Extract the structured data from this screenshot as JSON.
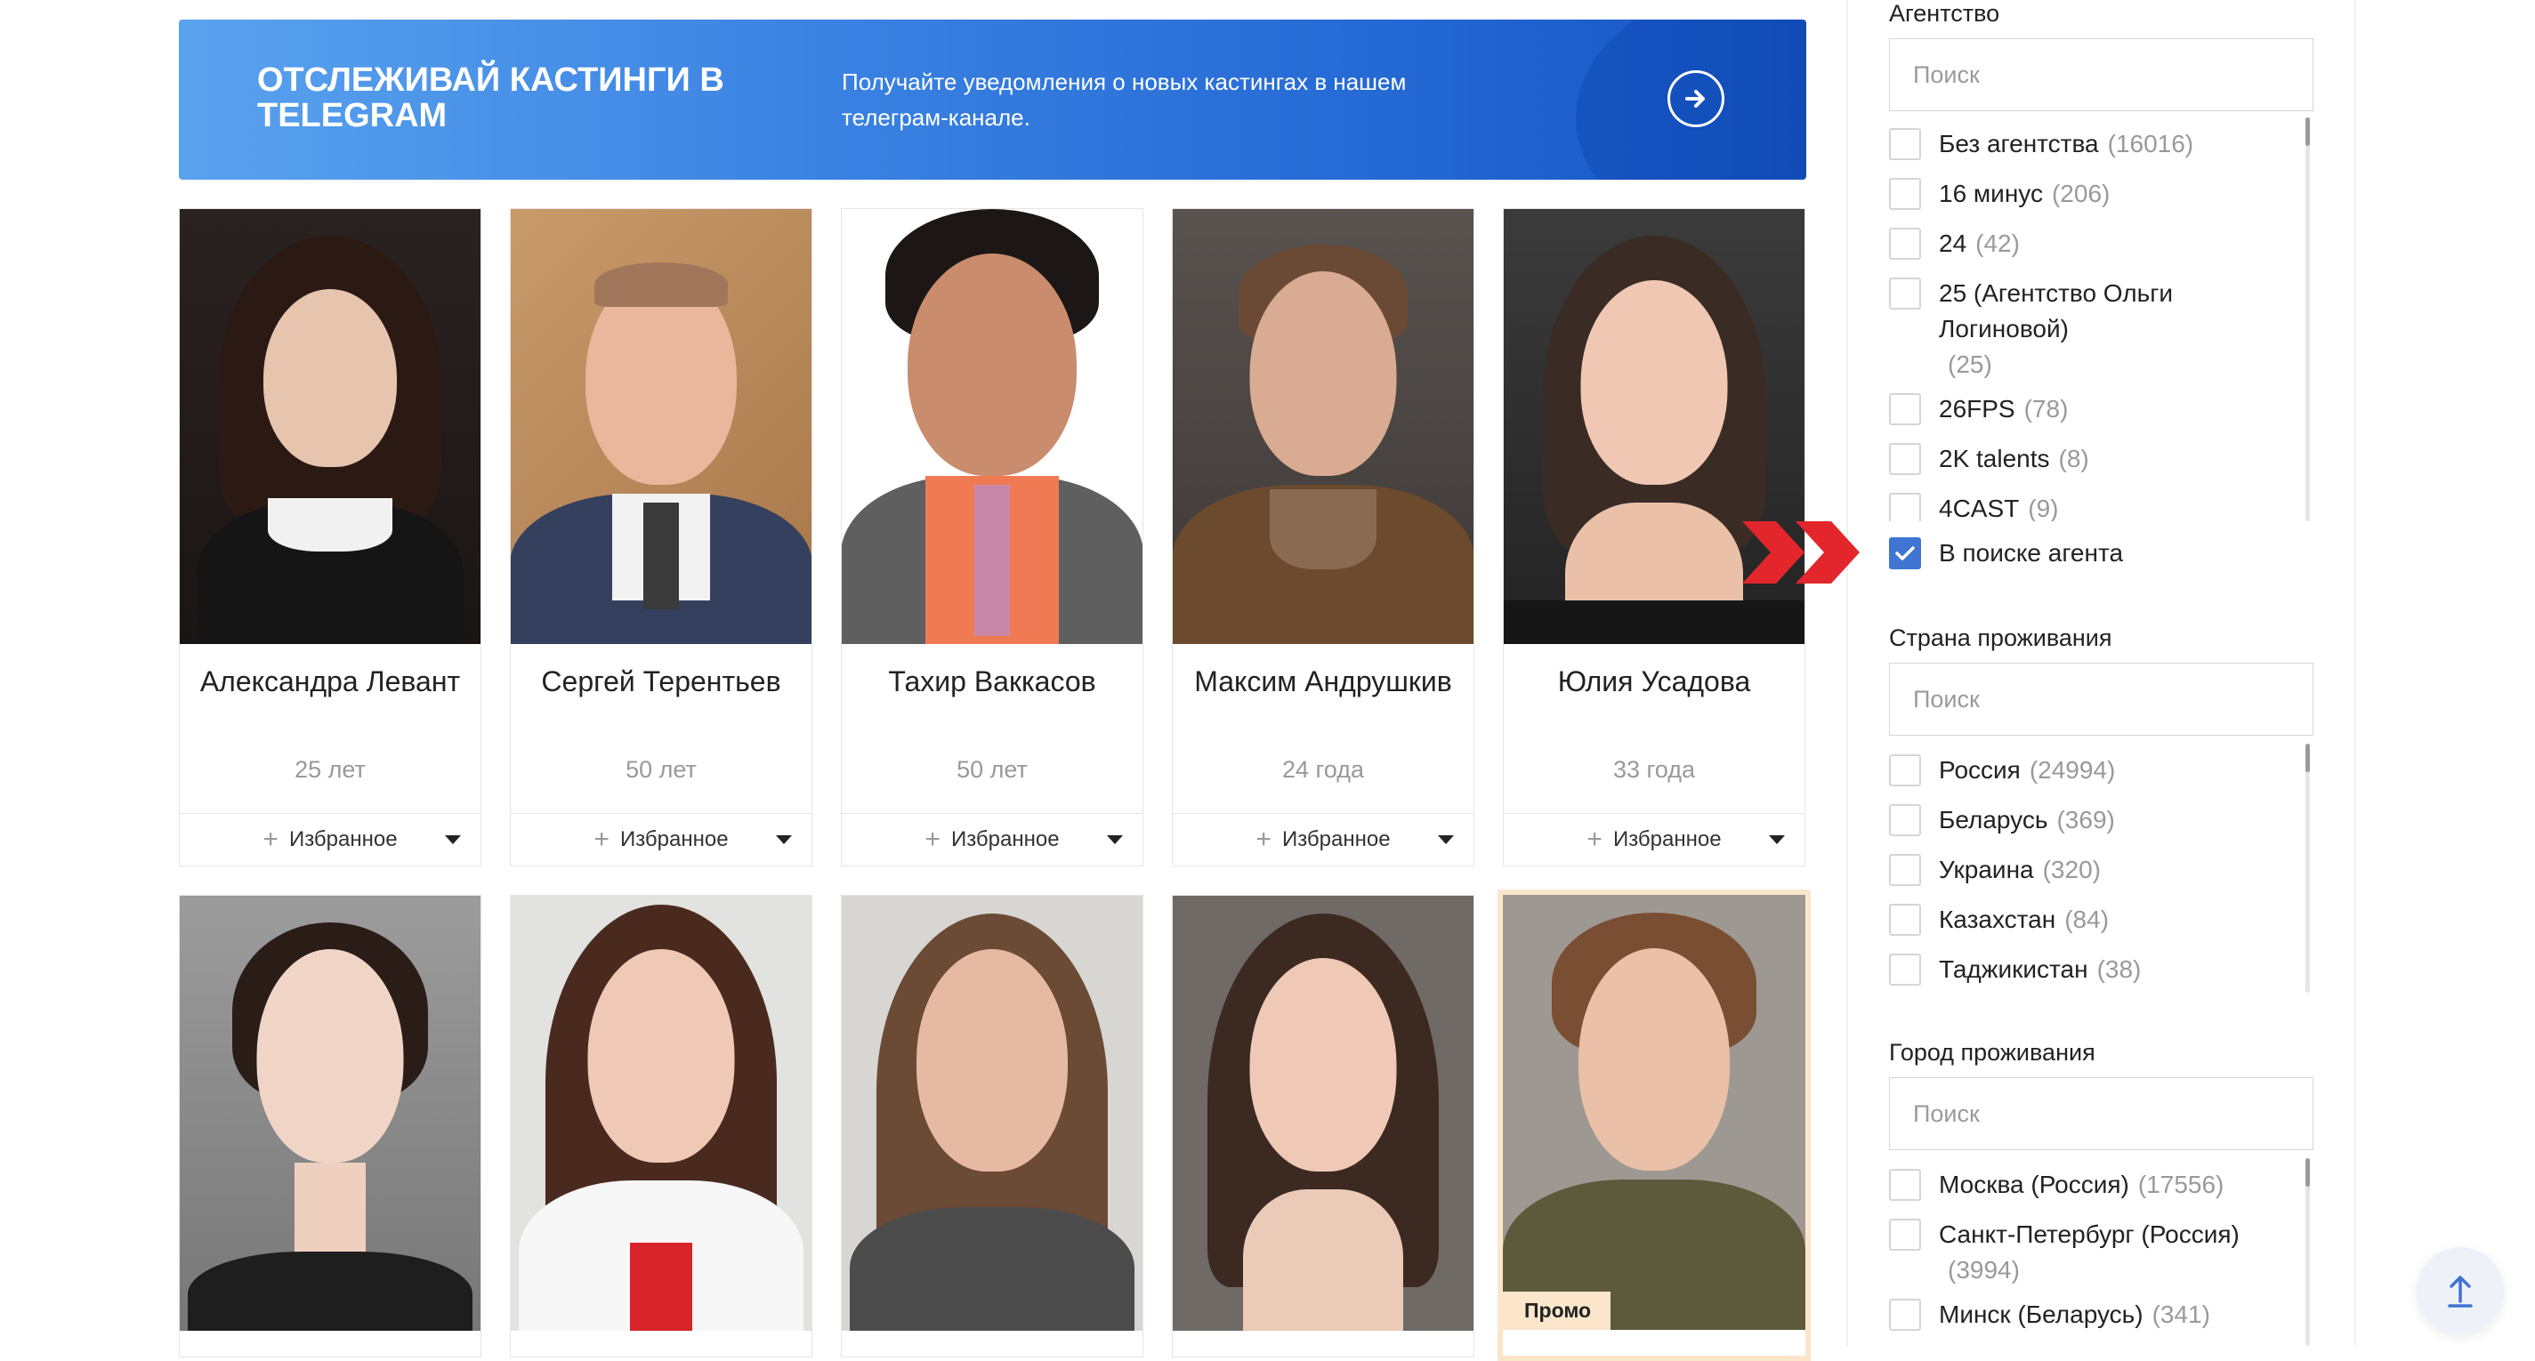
{
  "banner": {
    "title": "ОТСЛЕЖИВАЙ КАСТИНГИ В TELEGRAM",
    "text": "Получайте уведомления о новых кастингах в нашем телеграм-канале.",
    "button_icon": "arrow-right-icon"
  },
  "cards": [
    {
      "name": "Александра Левант",
      "age": "25 лет",
      "fav": "Избранное"
    },
    {
      "name": "Сергей Терентьев",
      "age": "50 лет",
      "fav": "Избранное"
    },
    {
      "name": "Тахир Ваккасов",
      "age": "50 лет",
      "fav": "Избранное"
    },
    {
      "name": "Максим Андрушкив",
      "age": "24 года",
      "fav": "Избранное"
    },
    {
      "name": "Юлия Усадова",
      "age": "33 года",
      "fav": "Избранное"
    }
  ],
  "promo": {
    "label": "Промо"
  },
  "sidebar": {
    "agency": {
      "title": "Агентство",
      "search_placeholder": "Поиск",
      "options": [
        {
          "label": "Без агентства",
          "count": "(16016)"
        },
        {
          "label": "16 минус",
          "count": "(206)"
        },
        {
          "label": "24",
          "count": "(42)"
        },
        {
          "label": "25 (Агентство Ольги Логиновой)",
          "count": "(25)"
        },
        {
          "label": "26FPS",
          "count": "(78)"
        },
        {
          "label": "2K talents",
          "count": "(8)"
        },
        {
          "label": "4CAST",
          "count": "(9)"
        }
      ],
      "checked_option": {
        "label": "В поиске агента",
        "checked": true
      }
    },
    "country": {
      "title": "Страна проживания",
      "search_placeholder": "Поиск",
      "options": [
        {
          "label": "Россия",
          "count": "(24994)"
        },
        {
          "label": "Беларусь",
          "count": "(369)"
        },
        {
          "label": "Украина",
          "count": "(320)"
        },
        {
          "label": "Казахстан",
          "count": "(84)"
        },
        {
          "label": "Таджикистан",
          "count": "(38)"
        }
      ]
    },
    "city": {
      "title": "Город проживания",
      "search_placeholder": "Поиск",
      "options": [
        {
          "label": "Москва (Россия)",
          "count": "(17556)"
        },
        {
          "label": "Санкт-Петербург (Россия)",
          "count": "(3994)"
        },
        {
          "label": "Минск (Беларусь)",
          "count": "(341)"
        }
      ]
    }
  },
  "colors": {
    "accent": "#3f74d2",
    "banner_blue": "#2468d4",
    "arrow_red": "#e3262c",
    "promo_bg": "#fbe6cc"
  }
}
